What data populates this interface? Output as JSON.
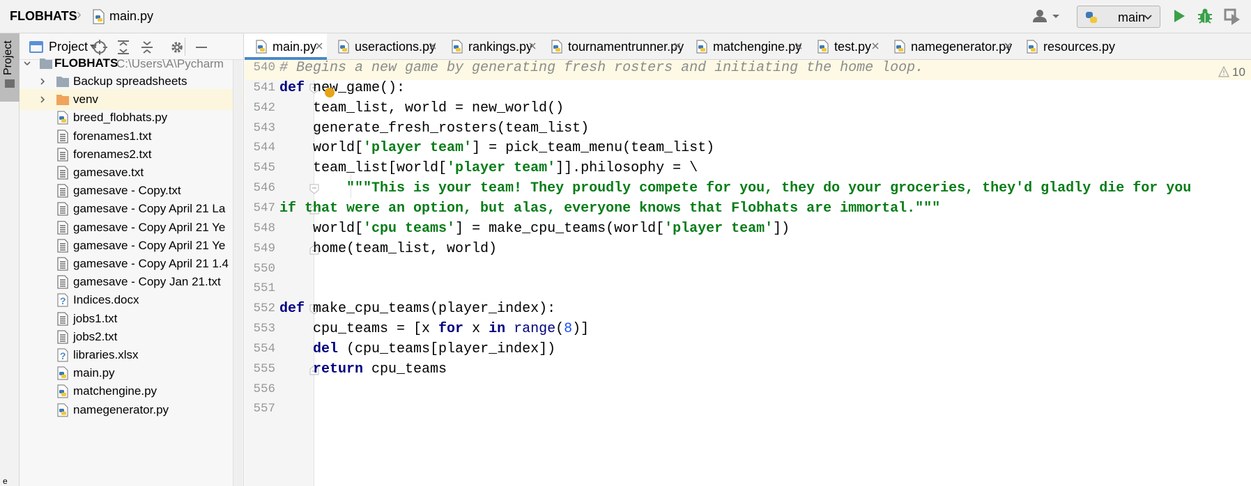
{
  "navbar": {
    "project": "FLOBHATS",
    "file": "main.py",
    "run_config": "main"
  },
  "stripe": {
    "project_tab": "Project",
    "bottom_label": "e"
  },
  "project_panel": {
    "title": "Project",
    "root": {
      "name": "FLOBHATS",
      "path": "C:\\Users\\A\\Pycharm"
    },
    "items": [
      {
        "name": "Backup spreadsheets",
        "kind": "folder"
      },
      {
        "name": "venv",
        "kind": "folder-venv"
      },
      {
        "name": "breed_flobhats.py",
        "kind": "py"
      },
      {
        "name": "forenames1.txt",
        "kind": "txt"
      },
      {
        "name": "forenames2.txt",
        "kind": "txt"
      },
      {
        "name": "gamesave.txt",
        "kind": "txt"
      },
      {
        "name": "gamesave - Copy.txt",
        "kind": "txt"
      },
      {
        "name": "gamesave - Copy April 21 La",
        "kind": "txt"
      },
      {
        "name": "gamesave - Copy April 21 Ye",
        "kind": "txt"
      },
      {
        "name": "gamesave - Copy April 21 Ye",
        "kind": "txt"
      },
      {
        "name": "gamesave - Copy April 21 1.4",
        "kind": "txt"
      },
      {
        "name": "gamesave - Copy Jan 21.txt",
        "kind": "txt"
      },
      {
        "name": "Indices.docx",
        "kind": "unknown"
      },
      {
        "name": "jobs1.txt",
        "kind": "txt"
      },
      {
        "name": "jobs2.txt",
        "kind": "txt"
      },
      {
        "name": "libraries.xlsx",
        "kind": "unknown"
      },
      {
        "name": "main.py",
        "kind": "py"
      },
      {
        "name": "matchengine.py",
        "kind": "py"
      },
      {
        "name": "namegenerator.py",
        "kind": "py"
      }
    ]
  },
  "tabs": [
    {
      "label": "main.py",
      "active": true
    },
    {
      "label": "useractions.py",
      "active": false
    },
    {
      "label": "rankings.py",
      "active": false
    },
    {
      "label": "tournamentrunner.py",
      "active": false
    },
    {
      "label": "matchengine.py",
      "active": false
    },
    {
      "label": "test.py",
      "active": false
    },
    {
      "label": "namegenerator.py",
      "active": false
    },
    {
      "label": "resources.py",
      "active": false
    }
  ],
  "editor": {
    "warning_count": "10",
    "lines": [
      {
        "n": "540",
        "segs": [
          [
            "comment",
            "# Begins a new game by generating fresh rosters and initiating the home loop."
          ]
        ]
      },
      {
        "n": "541",
        "segs": [
          [
            "kw",
            "def"
          ],
          [
            "",
            " new_game():"
          ]
        ]
      },
      {
        "n": "542",
        "segs": [
          [
            "",
            "    team_list, world = new_world()"
          ]
        ]
      },
      {
        "n": "543",
        "segs": [
          [
            "",
            "    generate_fresh_rosters(team_list)"
          ]
        ]
      },
      {
        "n": "544",
        "segs": [
          [
            "",
            "    world["
          ],
          [
            "str",
            "'player team'"
          ],
          [
            "",
            "] = pick_team_menu(team_list)"
          ]
        ]
      },
      {
        "n": "545",
        "segs": [
          [
            "",
            "    team_list[world["
          ],
          [
            "str",
            "'player team'"
          ],
          [
            "",
            "]].philosophy = \\"
          ]
        ]
      },
      {
        "n": "546",
        "segs": [
          [
            "str",
            "        \"\"\"This is your team! They proudly compete for you, they do your groceries, they'd gladly die for you"
          ]
        ]
      },
      {
        "n": "547",
        "segs": [
          [
            "str",
            "if that were an option, but alas, everyone knows that Flobhats are immortal.\"\"\""
          ]
        ]
      },
      {
        "n": "548",
        "segs": [
          [
            "",
            "    world["
          ],
          [
            "str",
            "'cpu teams'"
          ],
          [
            "",
            "] = make_cpu_teams(world["
          ],
          [
            "str",
            "'player team'"
          ],
          [
            "",
            "])"
          ]
        ]
      },
      {
        "n": "549",
        "segs": [
          [
            "",
            "    home(team_list, world)"
          ]
        ]
      },
      {
        "n": "550",
        "segs": []
      },
      {
        "n": "551",
        "segs": []
      },
      {
        "n": "552",
        "segs": [
          [
            "kw",
            "def"
          ],
          [
            "",
            " make_cpu_teams(player_index):"
          ]
        ]
      },
      {
        "n": "553",
        "segs": [
          [
            "",
            "    cpu_teams = [x "
          ],
          [
            "kw",
            "for"
          ],
          [
            "",
            " x "
          ],
          [
            "kw",
            "in"
          ],
          [
            "",
            " "
          ],
          [
            "builtin",
            "range"
          ],
          [
            "",
            "("
          ],
          [
            "num",
            "8"
          ],
          [
            "",
            ")]"
          ]
        ]
      },
      {
        "n": "554",
        "segs": [
          [
            "",
            "    "
          ],
          [
            "kw",
            "del"
          ],
          [
            "",
            " (cpu_teams[player_index])"
          ]
        ]
      },
      {
        "n": "555",
        "segs": [
          [
            "",
            "    "
          ],
          [
            "kw",
            "return"
          ],
          [
            "",
            " cpu_teams"
          ]
        ]
      },
      {
        "n": "556",
        "segs": []
      },
      {
        "n": "557",
        "segs": []
      }
    ]
  }
}
